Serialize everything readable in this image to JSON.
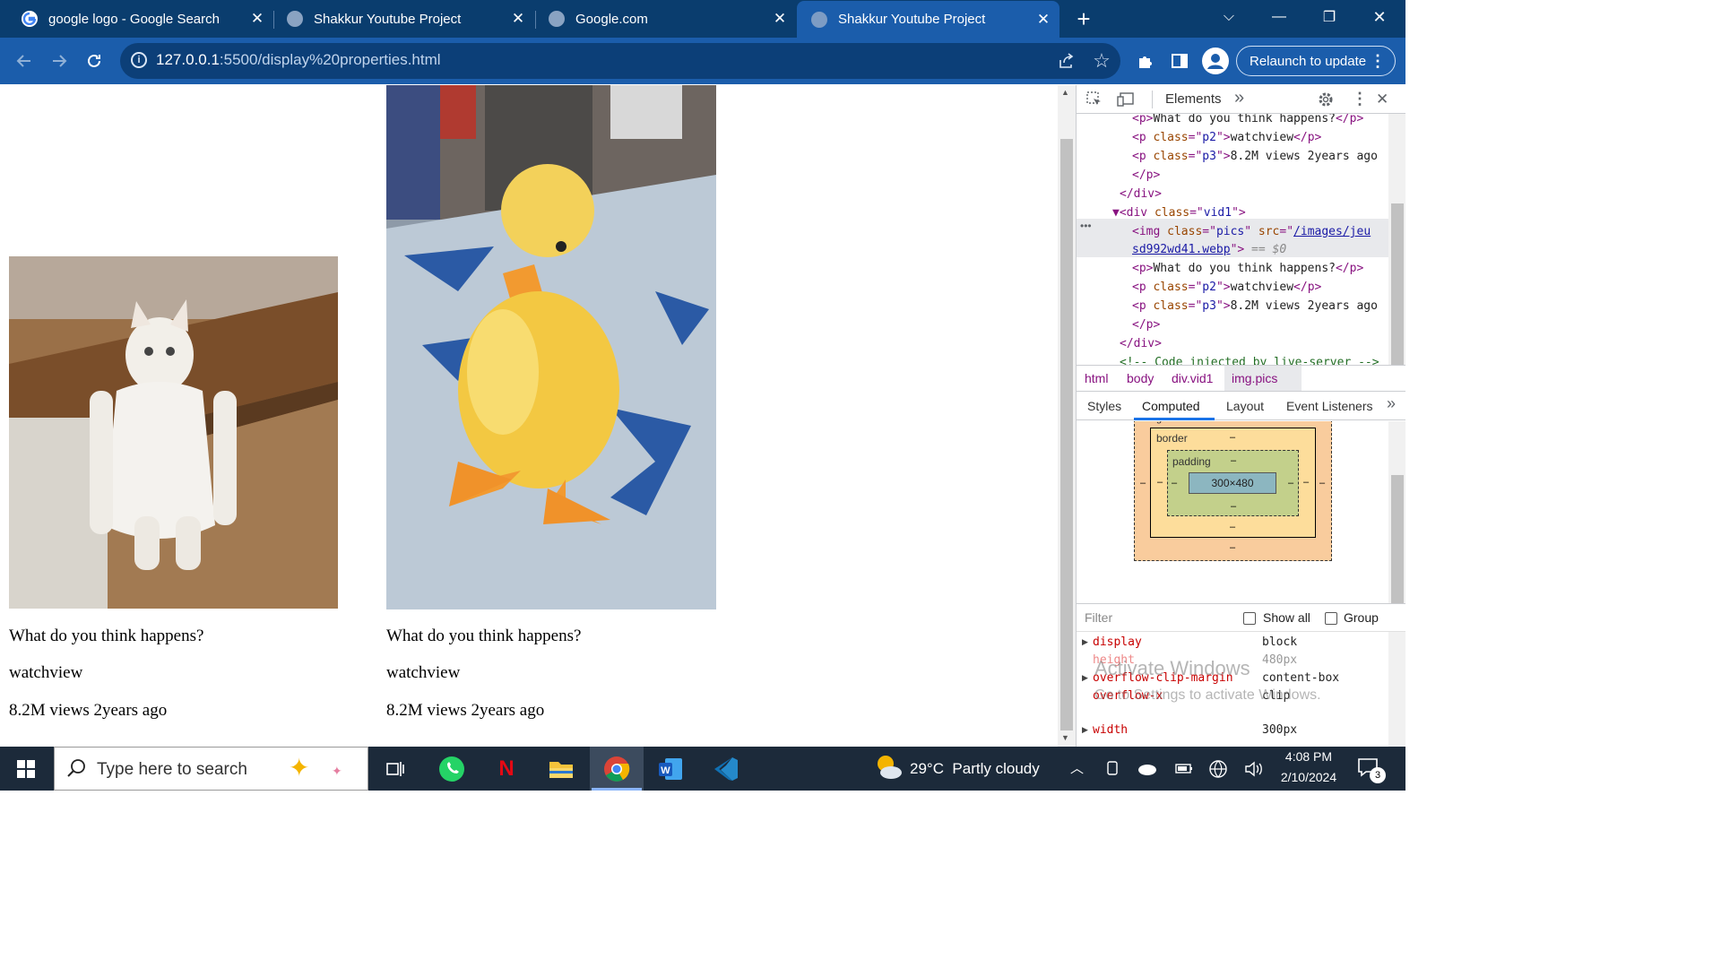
{
  "tabs": [
    {
      "title": "google logo - Google Search",
      "close": "✕"
    },
    {
      "title": "Shakkur Youtube Project",
      "close": "✕"
    },
    {
      "title": "Google.com",
      "close": "✕"
    },
    {
      "title": "Shakkur Youtube Project",
      "close": "✕"
    }
  ],
  "new_tab": "+",
  "window": {
    "dropdown": "⌵",
    "minimize": "—",
    "restore": "❐",
    "close": "✕"
  },
  "toolbar": {
    "url_host": "127.0.0.1",
    "url_rest": ":5500/display%20properties.html",
    "relaunch_label": "Relaunch to update",
    "menu": "⋮"
  },
  "page": {
    "cards": [
      {
        "title": "What do you think happens?",
        "channel": "watchview",
        "meta": "8.2M views 2years ago"
      },
      {
        "title": "What do you think happens?",
        "channel": "watchview",
        "meta": "8.2M views 2years ago"
      }
    ]
  },
  "devtools": {
    "panel_tab": "Elements",
    "more": "»",
    "close": "✕",
    "lines": [
      {
        "parts": [
          [
            "tg",
            "<p>"
          ],
          [
            "tx",
            "What do you think happens?"
          ],
          [
            "tg",
            "</p>"
          ]
        ]
      },
      {
        "parts": [
          [
            "tg",
            "<p "
          ],
          [
            "an",
            "class"
          ],
          [
            "tg",
            "=\""
          ],
          [
            "av",
            "p2"
          ],
          [
            "tg",
            "\">"
          ],
          [
            "tx",
            "watchview"
          ],
          [
            "tg",
            "</p>"
          ]
        ]
      },
      {
        "parts": [
          [
            "tg",
            "<p "
          ],
          [
            "an",
            "class"
          ],
          [
            "tg",
            "=\""
          ],
          [
            "av",
            "p3"
          ],
          [
            "tg",
            "\">"
          ],
          [
            "tx",
            "8.2M views 2years ago"
          ]
        ]
      },
      {
        "parts": [
          [
            "tg",
            "</p>"
          ]
        ]
      },
      {
        "parts": [
          [
            "tg",
            "</div>"
          ]
        ]
      },
      {
        "parts": [
          [
            "tg",
            "▼<div "
          ],
          [
            "an",
            "class"
          ],
          [
            "tg",
            "=\""
          ],
          [
            "av",
            "vid1"
          ],
          [
            "tg",
            "\">"
          ]
        ]
      },
      {
        "parts": [
          [
            "tg",
            "<img "
          ],
          [
            "an",
            "class"
          ],
          [
            "tg",
            "=\""
          ],
          [
            "av",
            "pics"
          ],
          [
            "tg",
            "\" "
          ],
          [
            "an",
            "src"
          ],
          [
            "tg",
            "=\""
          ],
          [
            "av",
            "/images/jeu"
          ]
        ]
      },
      {
        "parts": [
          [
            "av",
            "sd992wd41.webp"
          ],
          [
            "tg",
            "\">"
          ],
          [
            "tx",
            " == $0"
          ]
        ]
      },
      {
        "parts": [
          [
            "tg",
            "<p>"
          ],
          [
            "tx",
            "What do you think happens?"
          ],
          [
            "tg",
            "</p>"
          ]
        ]
      },
      {
        "parts": [
          [
            "tg",
            "<p "
          ],
          [
            "an",
            "class"
          ],
          [
            "tg",
            "=\""
          ],
          [
            "av",
            "p2"
          ],
          [
            "tg",
            "\">"
          ],
          [
            "tx",
            "watchview"
          ],
          [
            "tg",
            "</p>"
          ]
        ]
      },
      {
        "parts": [
          [
            "tg",
            "<p "
          ],
          [
            "an",
            "class"
          ],
          [
            "tg",
            "=\""
          ],
          [
            "av",
            "p3"
          ],
          [
            "tg",
            "\">"
          ],
          [
            "tx",
            "8.2M views 2years ago"
          ]
        ]
      },
      {
        "parts": [
          [
            "tg",
            "</p>"
          ]
        ]
      },
      {
        "parts": [
          [
            "tg",
            "</div>"
          ]
        ]
      },
      {
        "parts": [
          [
            "cm",
            "<!-- Code injected by live-server -->"
          ]
        ]
      }
    ],
    "breadcrumbs": [
      "html",
      "body",
      "div.vid1",
      "img.pics"
    ],
    "subtabs": [
      "Styles",
      "Computed",
      "Layout",
      "Event Listeners"
    ],
    "boxmodel": {
      "margin": "margin",
      "border": "border",
      "padding": "padding",
      "content": "300×480",
      "dash": "–"
    },
    "filter_placeholder": "Filter",
    "show_all": "Show all",
    "group": "Group",
    "props": [
      {
        "name": "display",
        "value": "block"
      },
      {
        "name": "height",
        "value": "480px"
      },
      {
        "name": "overflow-clip-margin",
        "value": "content-box"
      },
      {
        "name": "overflow-x",
        "value": "clip"
      },
      {
        "name": "width",
        "value": "300px"
      }
    ],
    "watermark1": "Activate Windows",
    "watermark2": "Go to Settings to activate Windows."
  },
  "taskbar": {
    "search_placeholder": "Type here to search",
    "weather": "29°C  Partly cloudy",
    "time": "4:08 PM",
    "date": "2/10/2024",
    "notif_count": "3"
  }
}
